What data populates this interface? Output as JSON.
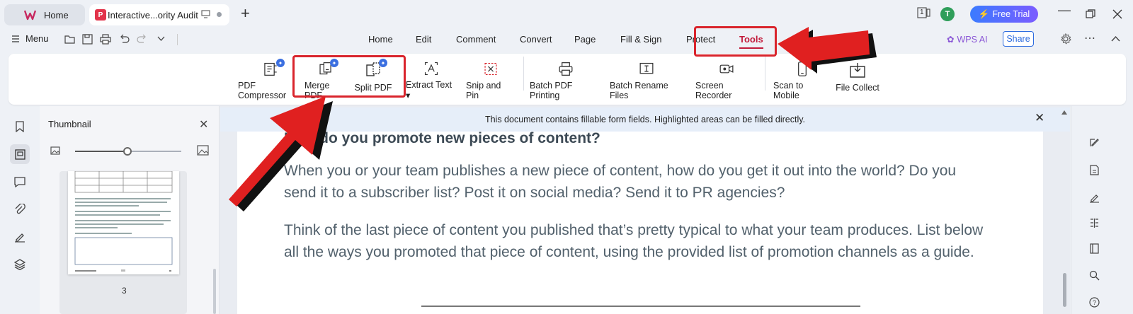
{
  "tabs": {
    "home_label": "Home",
    "doc_label": "Interactive...ority Audit",
    "new_tab": "+"
  },
  "titlebar": {
    "page_count_badge": "1",
    "avatar_letter": "T",
    "free_trial_label": "Free Trial"
  },
  "menubar": {
    "menu_label": "Menu",
    "tabs": [
      "Home",
      "Edit",
      "Comment",
      "Convert",
      "Page",
      "Fill & Sign",
      "Protect",
      "Tools"
    ],
    "active_tab": "Tools",
    "wps_ai_label": "WPS AI",
    "share_label": "Share"
  },
  "ribbon": {
    "tools": [
      {
        "label": "PDF Compressor",
        "icon": "compress-icon"
      },
      {
        "label": "Merge PDF",
        "icon": "merge-icon"
      },
      {
        "label": "Split PDF",
        "icon": "split-icon"
      },
      {
        "label": "Extract Text",
        "icon": "extract-text-icon"
      },
      {
        "label": "Snip and Pin",
        "icon": "snip-icon"
      },
      {
        "label": "Batch PDF Printing",
        "icon": "printer-icon"
      },
      {
        "label": "Batch Rename Files",
        "icon": "rename-icon"
      },
      {
        "label": "Screen Recorder",
        "icon": "recorder-icon"
      },
      {
        "label": "Scan to Mobile",
        "icon": "mobile-icon"
      },
      {
        "label": "File Collect",
        "icon": "collect-icon"
      }
    ]
  },
  "thumbnail_panel": {
    "title": "Thumbnail",
    "page_number": "3",
    "zoom_level": 0.5
  },
  "document": {
    "notice": "This document contains fillable form fields. Highlighted areas can be filled directly.",
    "heading": "How do you promote new pieces of content?",
    "paragraph1": "When you or your team publishes a new piece of content, how do you get it out into the world? Do you send it to a subscriber list? Post it on social media? Send it to PR agencies?",
    "paragraph2": "Think of the last piece of content you published that’s pretty typical to what your team produces. List below all the ways you promoted that piece of content, using the provided list of promotion channels as a guide."
  },
  "colors": {
    "accent": "#c21a3a",
    "annotation_red": "#d9242c",
    "free_trial": "#3b7bff",
    "link_blue": "#2d6cdf"
  }
}
